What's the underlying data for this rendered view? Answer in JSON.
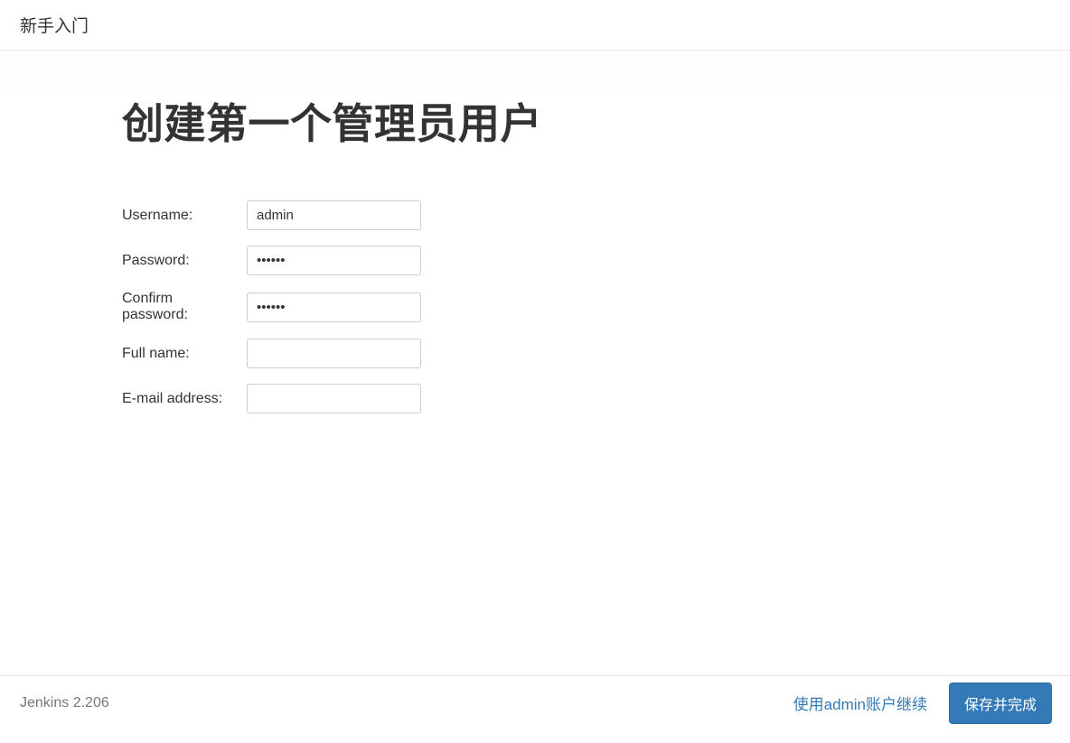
{
  "header": {
    "title": "新手入门"
  },
  "main": {
    "heading": "创建第一个管理员用户",
    "fields": {
      "username": {
        "label": "Username:",
        "value": "admin",
        "type": "text"
      },
      "password": {
        "label": "Password:",
        "value": "••••••",
        "type": "password"
      },
      "confirm": {
        "label": "Confirm password:",
        "value": "••••••",
        "type": "password"
      },
      "fullname": {
        "label": "Full name:",
        "value": "",
        "type": "text"
      },
      "email": {
        "label": "E-mail address:",
        "value": "",
        "type": "text"
      }
    }
  },
  "footer": {
    "version": "Jenkins 2.206",
    "secondary_action": "使用admin账户继续",
    "primary_action": "保存并完成"
  }
}
